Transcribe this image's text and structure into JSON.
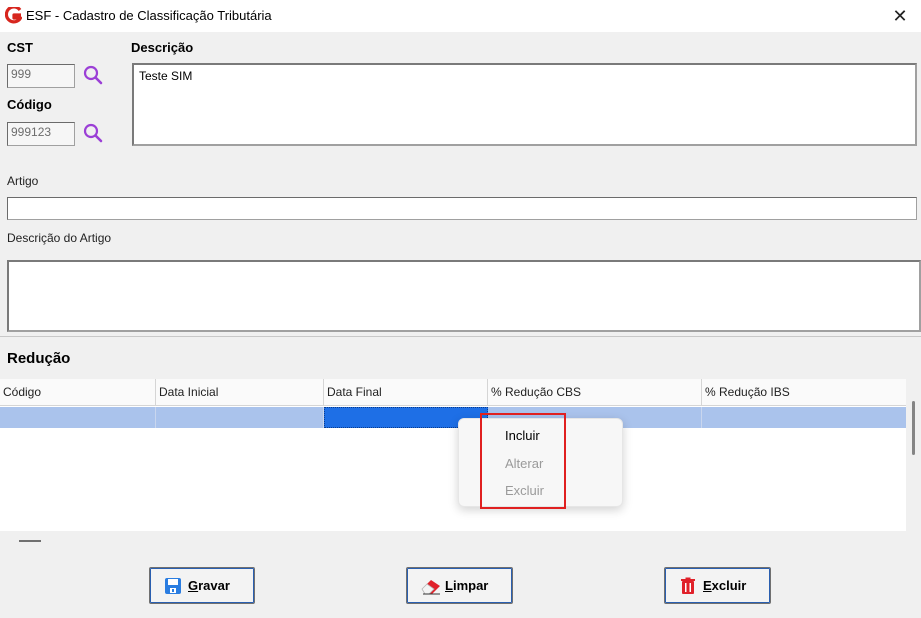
{
  "window": {
    "title": "ESF - Cadastro de Classificação Tributária",
    "close_glyph": "✕",
    "logo_icon": "app-g-logo-icon"
  },
  "fields": {
    "cst": {
      "label": "CST",
      "value": "999"
    },
    "codigo": {
      "label": "Código",
      "value": "999123"
    },
    "descricao": {
      "label": "Descrição",
      "value": "Teste SIM"
    },
    "artigo": {
      "label": "Artigo",
      "value": ""
    },
    "descricao_artigo": {
      "label": "Descrição do Artigo",
      "value": ""
    }
  },
  "reducao": {
    "section_title": "Redução",
    "columns": [
      "Código",
      "Data Inicial",
      "Data Final",
      "% Redução CBS",
      "% Redução IBS"
    ],
    "rows": [
      [
        "",
        "",
        "",
        "",
        ""
      ]
    ]
  },
  "context_menu": {
    "items": [
      {
        "label": "Incluir",
        "enabled": true
      },
      {
        "label": "Alterar",
        "enabled": false
      },
      {
        "label": "Excluir",
        "enabled": false
      }
    ]
  },
  "buttons": {
    "gravar": {
      "label_first": "G",
      "label_rest": "ravar"
    },
    "limpar": {
      "label_first": "L",
      "label_rest": "impar"
    },
    "excluir": {
      "label_first": "E",
      "label_rest": "xcluir"
    }
  },
  "colors": {
    "accent_magnifier": "#9b3fd6",
    "selection_row": "#aac3ec",
    "selection_cell": "#1e6fe6",
    "highlight_box": "#e02020"
  }
}
